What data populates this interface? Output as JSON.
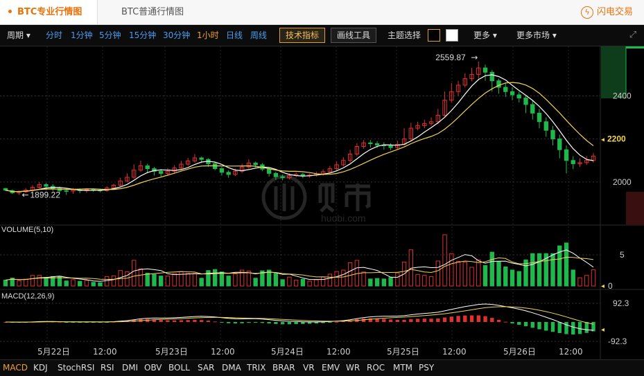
{
  "tabs": {
    "active": "BTC专业行情图",
    "normal": "BTC普通行情图"
  },
  "flash_trade": {
    "icon": "lightning-icon",
    "label": "闪电交易"
  },
  "toolbar": {
    "period_label": "周期 ▾",
    "periods": [
      "分时",
      "1分钟",
      "5分钟",
      "15分钟",
      "30分钟",
      "1小时",
      "日线",
      "周线"
    ],
    "selected_period": "1小时",
    "indicators_button": "技术指标",
    "draw_tools_button": "画线工具",
    "theme_label": "主题选择",
    "more_label": "更多 ▾",
    "more_markets_label": "更多市场 ▾"
  },
  "colors": {
    "up": "#e03030",
    "down": "#1fb84d",
    "ma5": "#ffffff",
    "ma10": "#f2d54c",
    "accent": "#f0a030"
  },
  "chart_data": {
    "type": "candlestick",
    "price_axis": {
      "ticks": [
        2000,
        2200,
        2400
      ],
      "current_price_label": "2200",
      "min": 1800,
      "max": 2630
    },
    "annotations": {
      "high_label": "2559.87",
      "low_label": "1899.22"
    },
    "x_labels": [
      "5月22日",
      "12:00",
      "5月23日",
      "12:00",
      "5月24日",
      "12:00",
      "5月25日",
      "12:00",
      "5月26日",
      "12:00"
    ],
    "volume_panel": {
      "title": "VOLUME(5,10)",
      "ticks": [
        "5",
        "0"
      ]
    },
    "macd_panel": {
      "title": "MACD(12,26,9)",
      "ticks": [
        "92.3",
        "-92.3"
      ]
    },
    "candles": [
      [
        1970,
        1962,
        1972,
        1958
      ],
      [
        1960,
        1950,
        1965,
        1944
      ],
      [
        1950,
        1955,
        1960,
        1940
      ],
      [
        1955,
        1962,
        1972,
        1948
      ],
      [
        1962,
        1975,
        1985,
        1955
      ],
      [
        1975,
        1988,
        2000,
        1970
      ],
      [
        1988,
        1980,
        1995,
        1962
      ],
      [
        1980,
        1970,
        1990,
        1958
      ],
      [
        1970,
        1960,
        1978,
        1945
      ],
      [
        1960,
        1958,
        1968,
        1940
      ],
      [
        1958,
        1963,
        1972,
        1945
      ],
      [
        1963,
        1960,
        1970,
        1948
      ],
      [
        1960,
        1965,
        1972,
        1950
      ],
      [
        1965,
        1962,
        1970,
        1955
      ],
      [
        1962,
        1960,
        1968,
        1952
      ],
      [
        1960,
        1972,
        1980,
        1955
      ],
      [
        1972,
        1985,
        1992,
        1965
      ],
      [
        1985,
        2005,
        2020,
        1980
      ],
      [
        2005,
        2022,
        2040,
        1998
      ],
      [
        2022,
        2055,
        2082,
        2015
      ],
      [
        2055,
        2075,
        2100,
        2048
      ],
      [
        2075,
        2062,
        2085,
        2040
      ],
      [
        2062,
        2050,
        2070,
        2030
      ],
      [
        2050,
        2040,
        2060,
        2025
      ],
      [
        2040,
        2050,
        2065,
        2030
      ],
      [
        2050,
        2065,
        2078,
        2042
      ],
      [
        2065,
        2083,
        2098,
        2058
      ],
      [
        2083,
        2098,
        2112,
        2075
      ],
      [
        2098,
        2112,
        2130,
        2090
      ],
      [
        2112,
        2105,
        2118,
        2088
      ],
      [
        2105,
        2085,
        2110,
        2070
      ],
      [
        2085,
        2062,
        2092,
        2055
      ],
      [
        2062,
        2045,
        2070,
        2030
      ],
      [
        2045,
        2035,
        2055,
        2020
      ],
      [
        2035,
        2050,
        2062,
        2028
      ],
      [
        2050,
        2070,
        2085,
        2042
      ],
      [
        2070,
        2088,
        2105,
        2062
      ],
      [
        2088,
        2080,
        2095,
        2068
      ],
      [
        2080,
        2060,
        2088,
        2050
      ],
      [
        2060,
        2040,
        2068,
        2025
      ],
      [
        2040,
        2025,
        2048,
        2010
      ],
      [
        2025,
        2020,
        2035,
        2008
      ],
      [
        2020,
        2030,
        2040,
        2012
      ],
      [
        2030,
        2035,
        2045,
        2022
      ],
      [
        2035,
        2028,
        2042,
        2018
      ],
      [
        2028,
        2032,
        2040,
        2020
      ],
      [
        2032,
        2038,
        2048,
        2025
      ],
      [
        2038,
        2048,
        2058,
        2030
      ],
      [
        2048,
        2062,
        2075,
        2040
      ],
      [
        2062,
        2080,
        2095,
        2055
      ],
      [
        2080,
        2100,
        2115,
        2072
      ],
      [
        2100,
        2130,
        2150,
        2090
      ],
      [
        2130,
        2165,
        2180,
        2120
      ],
      [
        2165,
        2182,
        2195,
        2155
      ],
      [
        2182,
        2178,
        2195,
        2160
      ],
      [
        2178,
        2172,
        2190,
        2158
      ],
      [
        2172,
        2168,
        2185,
        2150
      ],
      [
        2168,
        2160,
        2180,
        2148
      ],
      [
        2160,
        2175,
        2192,
        2152
      ],
      [
        2175,
        2200,
        2250,
        2168
      ],
      [
        2200,
        2250,
        2275,
        2192
      ],
      [
        2250,
        2262,
        2280,
        2240
      ],
      [
        2262,
        2272,
        2290,
        2250
      ],
      [
        2272,
        2280,
        2300,
        2262
      ],
      [
        2280,
        2310,
        2340,
        2268
      ],
      [
        2310,
        2380,
        2420,
        2300
      ],
      [
        2380,
        2420,
        2460,
        2370
      ],
      [
        2420,
        2450,
        2470,
        2400
      ],
      [
        2450,
        2480,
        2505,
        2440
      ],
      [
        2480,
        2500,
        2530,
        2468
      ],
      [
        2500,
        2530,
        2559.87,
        2480
      ],
      [
        2530,
        2510,
        2545,
        2470
      ],
      [
        2510,
        2470,
        2520,
        2420
      ],
      [
        2470,
        2440,
        2480,
        2410
      ],
      [
        2440,
        2420,
        2460,
        2395
      ],
      [
        2420,
        2405,
        2440,
        2380
      ],
      [
        2405,
        2390,
        2420,
        2370
      ],
      [
        2390,
        2360,
        2400,
        2320
      ],
      [
        2360,
        2320,
        2380,
        2290
      ],
      [
        2320,
        2280,
        2340,
        2250
      ],
      [
        2280,
        2240,
        2300,
        2210
      ],
      [
        2240,
        2200,
        2260,
        2170
      ],
      [
        2200,
        2150,
        2220,
        2110
      ],
      [
        2150,
        2100,
        2170,
        2040
      ],
      [
        2100,
        2085,
        2120,
        2060
      ],
      [
        2085,
        2090,
        2110,
        2070
      ],
      [
        2090,
        2100,
        2120,
        2080
      ],
      [
        2100,
        2120,
        2135,
        2090
      ]
    ]
  }
}
